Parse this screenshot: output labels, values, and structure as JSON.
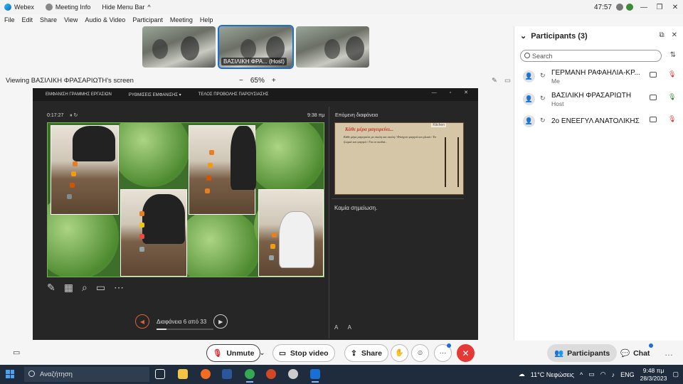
{
  "titlebar": {
    "app_name": "Webex",
    "meeting_info": "Meeting Info",
    "hide_menu": "Hide Menu Bar",
    "hide_menu_chevron": "^",
    "time": "47:57"
  },
  "menu": [
    "File",
    "Edit",
    "Share",
    "View",
    "Audio & Video",
    "Participant",
    "Meeting",
    "Help"
  ],
  "thumbnails": [
    {
      "caption": ""
    },
    {
      "caption": "ΒΑΣΙΛΙΚΗ ΦΡΑ... (Host)"
    },
    {
      "caption": ""
    }
  ],
  "viewbar": {
    "label": "Viewing ΒΑΣΙΛΙΚΗ ΦΡΑΣΑΡΙΩΤΗ's screen",
    "zoom_minus": "−",
    "zoom": "65%",
    "zoom_plus": "+"
  },
  "presenter": {
    "top_items": [
      "ΕΜΦΑΝΙΣΗ ΓΡΑΜΜΗΣ ΕΡΓΑΣΙΩΝ",
      "ΡΥΘΜΙΣΕΙΣ ΕΜΦΑΝΙΣΗΣ ▾",
      "ΤΕΛΟΣ ΠΡΟΒΟΛΗΣ ΠΑΡΟΥΣΙΑΣΗΣ"
    ],
    "timer": "0:17:27",
    "clock": "9:38 πμ",
    "next_label": "Επόμενη διαφάνεια",
    "slide_counter": "Διαφάνεια 6 από 33",
    "progress_fraction": 0.18,
    "notes": "Καμία σημείωση.",
    "next_slide_title": "Κάθε μέρα μαγειρεύει...",
    "next_slide_tag": "Kitchen",
    "next_slide_poem": "Κάθε μέρα μαγειρεύει με σκεύη και σκεύη / Φτιάχνει φαγητά και γλυκά / Τα ζουμιά και φαγητά / Για τα παιδιά..."
  },
  "participants": {
    "title": "Participants (3)",
    "search_placeholder": "Search",
    "list": [
      {
        "name": "ΓΕΡΜΑΝΗ ΡΑΦΑΗΛΙΑ-ΚΡ...",
        "sub": "Me",
        "mic": "muted"
      },
      {
        "name": "ΒΑΣΙΛΙΚΗ ΦΡΑΣΑΡΙΩΤΗ",
        "sub": "Host",
        "mic": "active"
      },
      {
        "name": "2ο ΕΝΕΕΓΥΛ ΑΝΑΤΟΛΙΚΗΣ...",
        "sub": "",
        "mic": "muted"
      }
    ]
  },
  "controls": {
    "unmute": "Unmute",
    "stop_video": "Stop video",
    "share": "Share",
    "participants": "Participants",
    "chat": "Chat",
    "more": "···"
  },
  "taskbar": {
    "search": "Αναζήτηση",
    "weather": "11°C Νεφώσεις",
    "lang": "ENG",
    "time": "9:48 πμ",
    "date": "28/3/2023"
  },
  "colors": {
    "accent": "#1a6fd4",
    "end_call": "#e53935",
    "mute_red": "#d32f2f",
    "taskbar": "#1f2c3d"
  }
}
